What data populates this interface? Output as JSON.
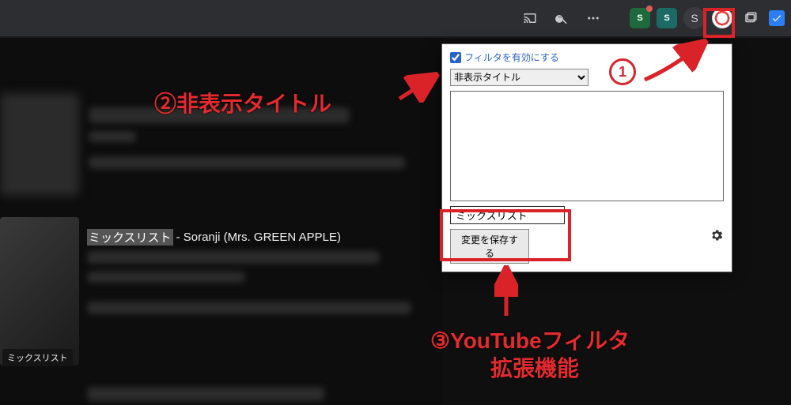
{
  "browser": {
    "profile_letter": "S",
    "badge1_letter": "S",
    "badge2_letter": "S"
  },
  "youtube": {
    "mix_highlight": "ミックスリスト",
    "mix_title_rest": " - Soranji (Mrs. GREEN APPLE)",
    "mix_tag": "ミックスリスト"
  },
  "popup": {
    "enable_label": "フィルタを有効にする",
    "select_value": "非表示タイトル",
    "keyword_value": "ミックスリスト",
    "save_label": "変更を保存する"
  },
  "annotations": {
    "num1": "1",
    "num2": "②非表示タイトル",
    "num3_line1": "③YouTubeフィルタ",
    "num3_line2": "拡張機能"
  }
}
